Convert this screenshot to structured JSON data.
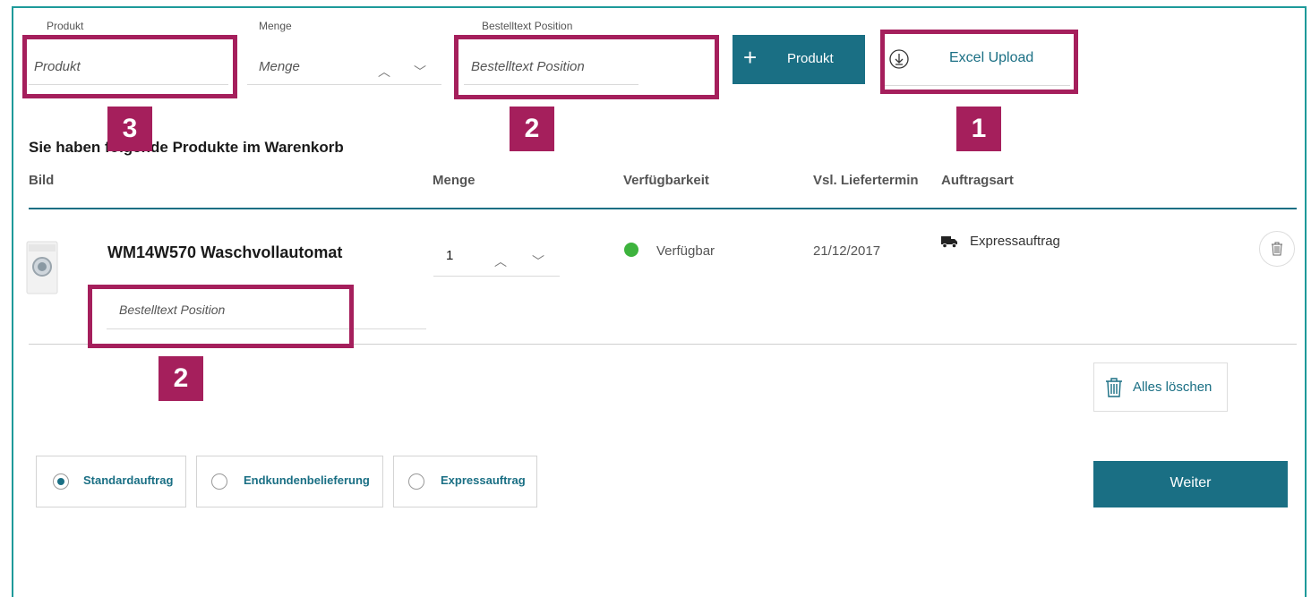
{
  "form": {
    "produkt_label": "Produkt",
    "produkt_placeholder": "Produkt",
    "menge_label": "Menge",
    "menge_placeholder": "Menge",
    "bestelltext_label": "Bestelltext Position",
    "bestelltext_placeholder": "Bestelltext Position",
    "add_product_label": "Produkt",
    "excel_upload_label": "Excel Upload"
  },
  "cart": {
    "heading": "Sie haben folgende Produkte im Warenkorb",
    "columns": [
      "Bild",
      "Menge",
      "Verfügbarkeit",
      "Vsl. Liefertermin",
      "Auftragsart"
    ],
    "item": {
      "name": "WM14W570 Waschvollautomat",
      "quantity": "1",
      "availability": "Verfügbar",
      "delivery_date": "21/12/2017",
      "order_type": "Expressauftrag",
      "bestelltext_placeholder": "Bestelltext Position"
    },
    "delete_all_label": "Alles löschen"
  },
  "order_types": {
    "options": [
      "Standardauftrag",
      "Endkundenbelieferung",
      "Expressauftrag"
    ],
    "selected": "Standardauftrag"
  },
  "next_label": "Weiter",
  "annotations": [
    "3",
    "2",
    "1",
    "2"
  ],
  "colors": {
    "accent": "#1a6f84",
    "frame": "#1e9a9a",
    "annotation": "#a51f5c",
    "available": "#3db33d"
  }
}
